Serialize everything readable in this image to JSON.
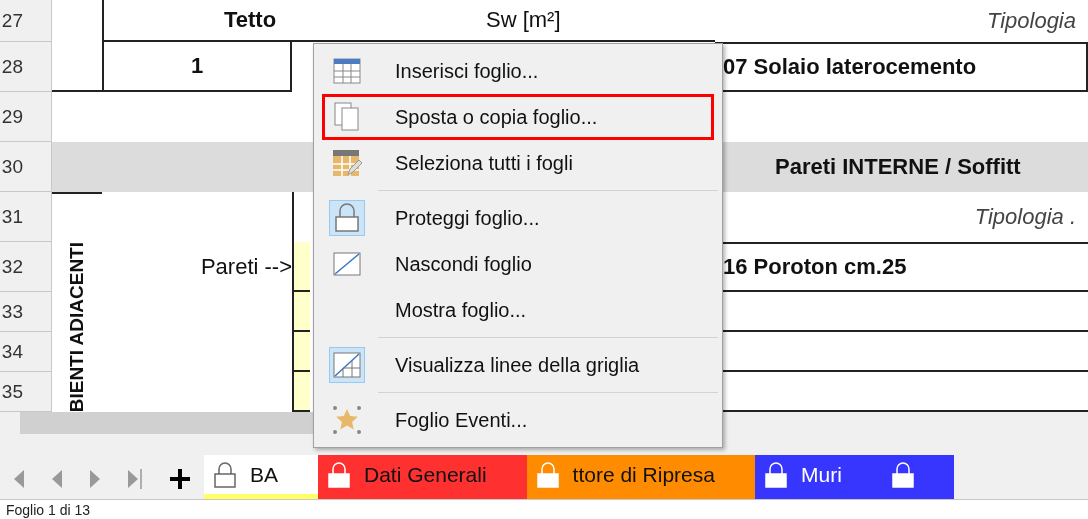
{
  "sheet": {
    "row_numbers": [
      "27",
      "28",
      "29",
      "30",
      "31",
      "32",
      "33",
      "34",
      "35"
    ],
    "roof": {
      "title": "Tetto",
      "area_label": "Sw [m²]",
      "type_label": "Tipologia",
      "number": "1",
      "type": "07 Solaio laterocemento"
    },
    "section_title": "Pareti INTERNE / Soffitt",
    "walls": {
      "side_label": "BIENTI ADIACENTI",
      "type_label": "Tipologia .",
      "row_label": "Pareti -->",
      "type": "16 Poroton cm.25"
    }
  },
  "context_menu": {
    "items": [
      {
        "label": "Inserisci foglio...",
        "kind": "table",
        "checked": false,
        "highlighted": false,
        "separator_before": false
      },
      {
        "label": "Sposta o copia foglio...",
        "kind": "copy",
        "checked": false,
        "highlighted": true,
        "separator_before": false
      },
      {
        "label": "Seleziona tutti i fogli",
        "kind": "select",
        "checked": false,
        "highlighted": false,
        "separator_before": false
      },
      {
        "label": "Proteggi foglio...",
        "kind": "lock",
        "checked": true,
        "highlighted": false,
        "separator_before": true
      },
      {
        "label": "Nascondi foglio",
        "kind": "hide",
        "checked": false,
        "highlighted": false,
        "separator_before": false
      },
      {
        "label": "Mostra foglio...",
        "checked": false,
        "highlighted": false,
        "separator_before": false
      },
      {
        "label": "Visualizza linee della griglia",
        "kind": "grid",
        "checked": true,
        "highlighted": false,
        "separator_before": true
      },
      {
        "label": "Foglio Eventi...",
        "kind": "star",
        "checked": false,
        "highlighted": false,
        "separator_before": true
      }
    ]
  },
  "sheet_tabs": [
    {
      "label": "BA",
      "color": "#ffff66",
      "locked": true,
      "selected": true
    },
    {
      "label": "Dati Generali",
      "color": "#ff3030",
      "locked": true,
      "selected": false
    },
    {
      "label": "ttore di Ripresa",
      "color": "#ff8c00",
      "locked": true,
      "selected": false
    },
    {
      "label": "Muri",
      "color": "#3636ff",
      "locked": true,
      "selected": false
    },
    {
      "color": "#3636ff",
      "locked": true,
      "selected": false
    }
  ],
  "status_bar": {
    "sheet_position": "Foglio 1 di 13"
  }
}
